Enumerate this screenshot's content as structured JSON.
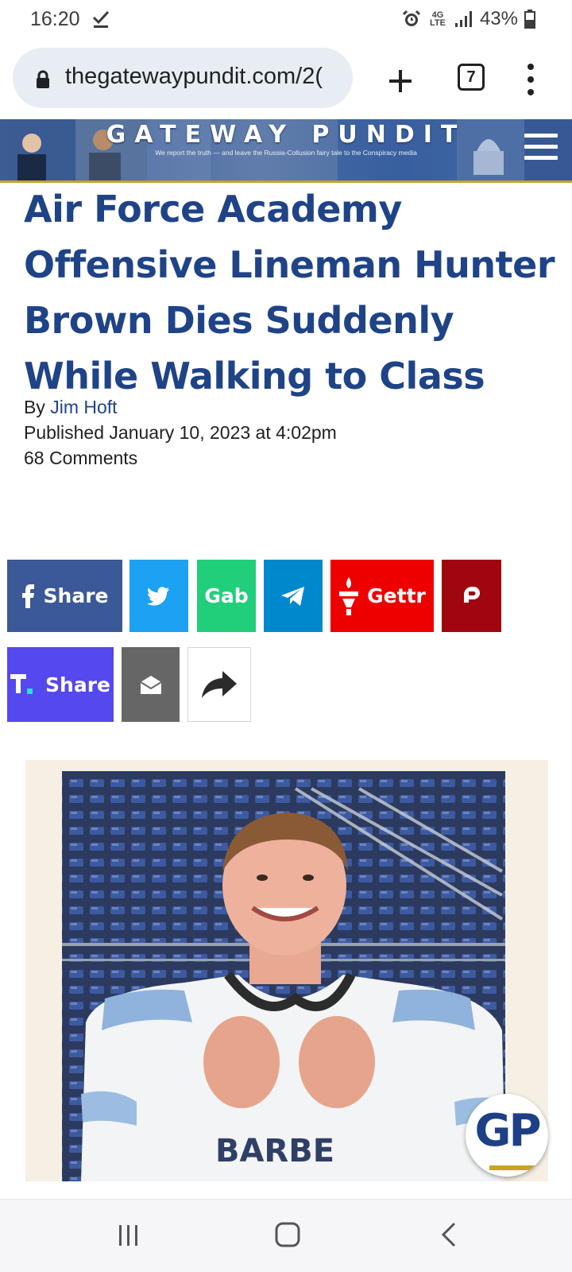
{
  "status_bar": {
    "time": "16:20",
    "network": "4G LTE",
    "battery_percent": "43%",
    "icons": [
      "check-icon",
      "alarm-icon",
      "signal-icon",
      "battery-icon"
    ]
  },
  "browser": {
    "url": "thegatewaypundit.com/2(",
    "tab_count": "7",
    "icons": [
      "lock-icon",
      "plus-icon",
      "more-vert-icon"
    ]
  },
  "site_header": {
    "title": "GATEWAY PUNDIT",
    "tagline": "We report the truth — and leave the Russia-Collusion fairy tale to the Conspiracy media"
  },
  "article": {
    "title": "Air Force Academy Offensive Lineman Hunter Brown Dies Suddenly While Walking to Class",
    "by_prefix": "By",
    "author": "Jim Hoft",
    "published": "Published January 10, 2023 at 4:02pm",
    "comments": "68 Comments"
  },
  "share": {
    "facebook": "Share",
    "gab": "Gab",
    "gettr": "Gettr",
    "truth": "Share"
  },
  "photo": {
    "jersey_text": "BARBE",
    "badge": "GP"
  },
  "colors": {
    "title_blue": "#1f4387",
    "facebook": "#3b5998",
    "twitter": "#1da1f2",
    "gab": "#21cf7a",
    "telegram": "#0088cc",
    "gettr": "#ef0000",
    "parler": "#a0060f",
    "truth": "#5448ee",
    "email": "#666666"
  }
}
